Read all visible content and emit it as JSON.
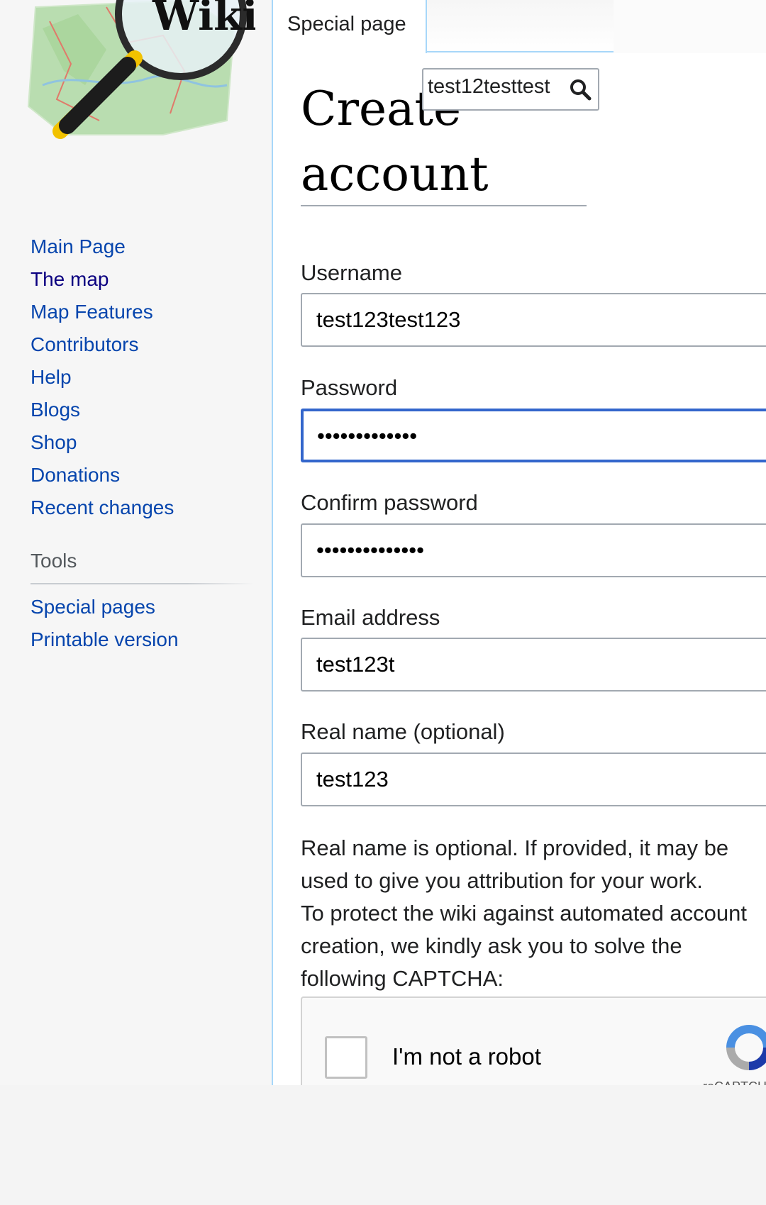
{
  "logo": {
    "text": "Wiki"
  },
  "sidebar": {
    "nav_items": [
      {
        "label": "Main Page",
        "visited": false
      },
      {
        "label": "The map",
        "visited": true
      },
      {
        "label": "Map Features",
        "visited": false
      },
      {
        "label": "Contributors",
        "visited": false
      },
      {
        "label": "Help",
        "visited": false
      },
      {
        "label": "Blogs",
        "visited": false
      },
      {
        "label": "Shop",
        "visited": false
      },
      {
        "label": "Donations",
        "visited": false
      },
      {
        "label": "Recent changes",
        "visited": false
      }
    ],
    "tools": {
      "heading": "Tools",
      "items": [
        {
          "label": "Special pages"
        },
        {
          "label": "Printable version"
        }
      ]
    }
  },
  "tabs": {
    "special_page": "Special page"
  },
  "search": {
    "value": "test12testtest"
  },
  "page": {
    "title_line1": "Create",
    "title_line2": "account"
  },
  "form": {
    "username": {
      "label": "Username",
      "value": "test123test123"
    },
    "password": {
      "label": "Password",
      "value": "•••••••••••••"
    },
    "confirm_password": {
      "label": "Confirm password",
      "value": "••••••••••••••"
    },
    "email": {
      "label": "Email address",
      "value": "test123t"
    },
    "real_name": {
      "label": "Real name (optional)",
      "value": "test123"
    },
    "help_lines": [
      "Real name is optional. If provided, it may be",
      "used to give you attribution for your work.",
      "To protect the wiki against automated account",
      "creation, we kindly ask you to solve the",
      "following CAPTCHA:"
    ]
  },
  "captcha": {
    "label": "I'm not a robot",
    "brand": "reCAPTCHA"
  },
  "colors": {
    "link": "#0645ad",
    "visited": "#0b0080",
    "focus": "#3366cc",
    "tab_border": "#a7d7f9"
  }
}
